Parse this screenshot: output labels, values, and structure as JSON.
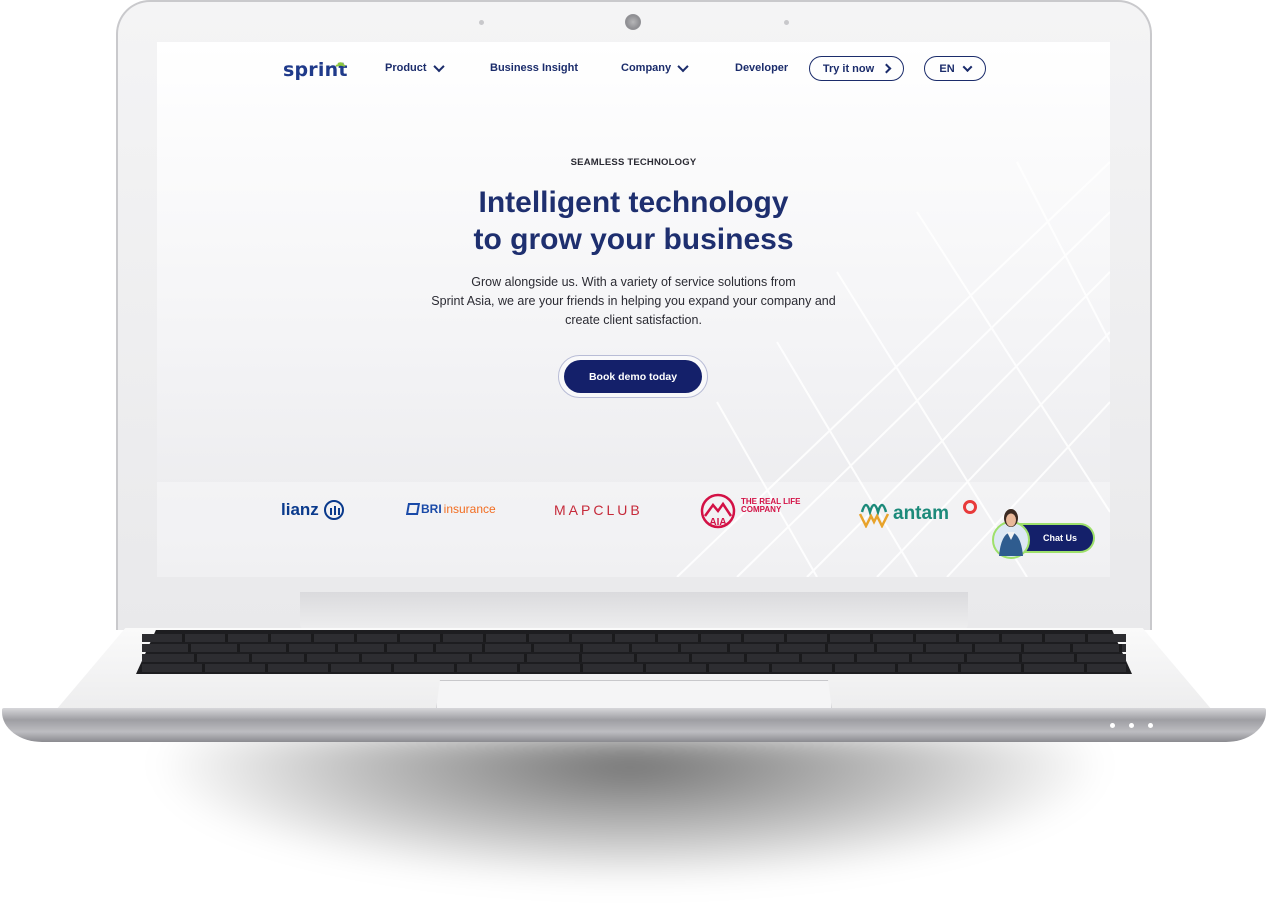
{
  "nav": {
    "logo": "sprint",
    "items": [
      {
        "label": "Product",
        "dropdown": true
      },
      {
        "label": "Business Insight",
        "dropdown": false
      },
      {
        "label": "Company",
        "dropdown": true
      },
      {
        "label": "Developer",
        "dropdown": false
      }
    ],
    "try_label": "Try it now",
    "lang_label": "EN"
  },
  "hero": {
    "eyebrow": "SEAMLESS TECHNOLOGY",
    "headline_line1": "Intelligent technology",
    "headline_line2": "to grow your business",
    "sub_line1": "Grow alongside us. With a variety of service solutions from",
    "sub_line2": "Sprint Asia, we are your friends in helping you expand your company and",
    "sub_line3": "create client satisfaction.",
    "cta_label": "Book demo today"
  },
  "partners": {
    "allianz": "lianz",
    "bri_bold": "BRI",
    "bri_rest": "insurance",
    "mapclub": "MAPCLUB",
    "aia_tag_line1": "THE REAL LIFE",
    "aia_tag_line2": "COMPANY",
    "antam": "antam"
  },
  "chat": {
    "label": "Chat Us"
  },
  "colors": {
    "brand_navy": "#14206a",
    "heading": "#1e2f6f",
    "chat_ring": "#9ee06b"
  }
}
